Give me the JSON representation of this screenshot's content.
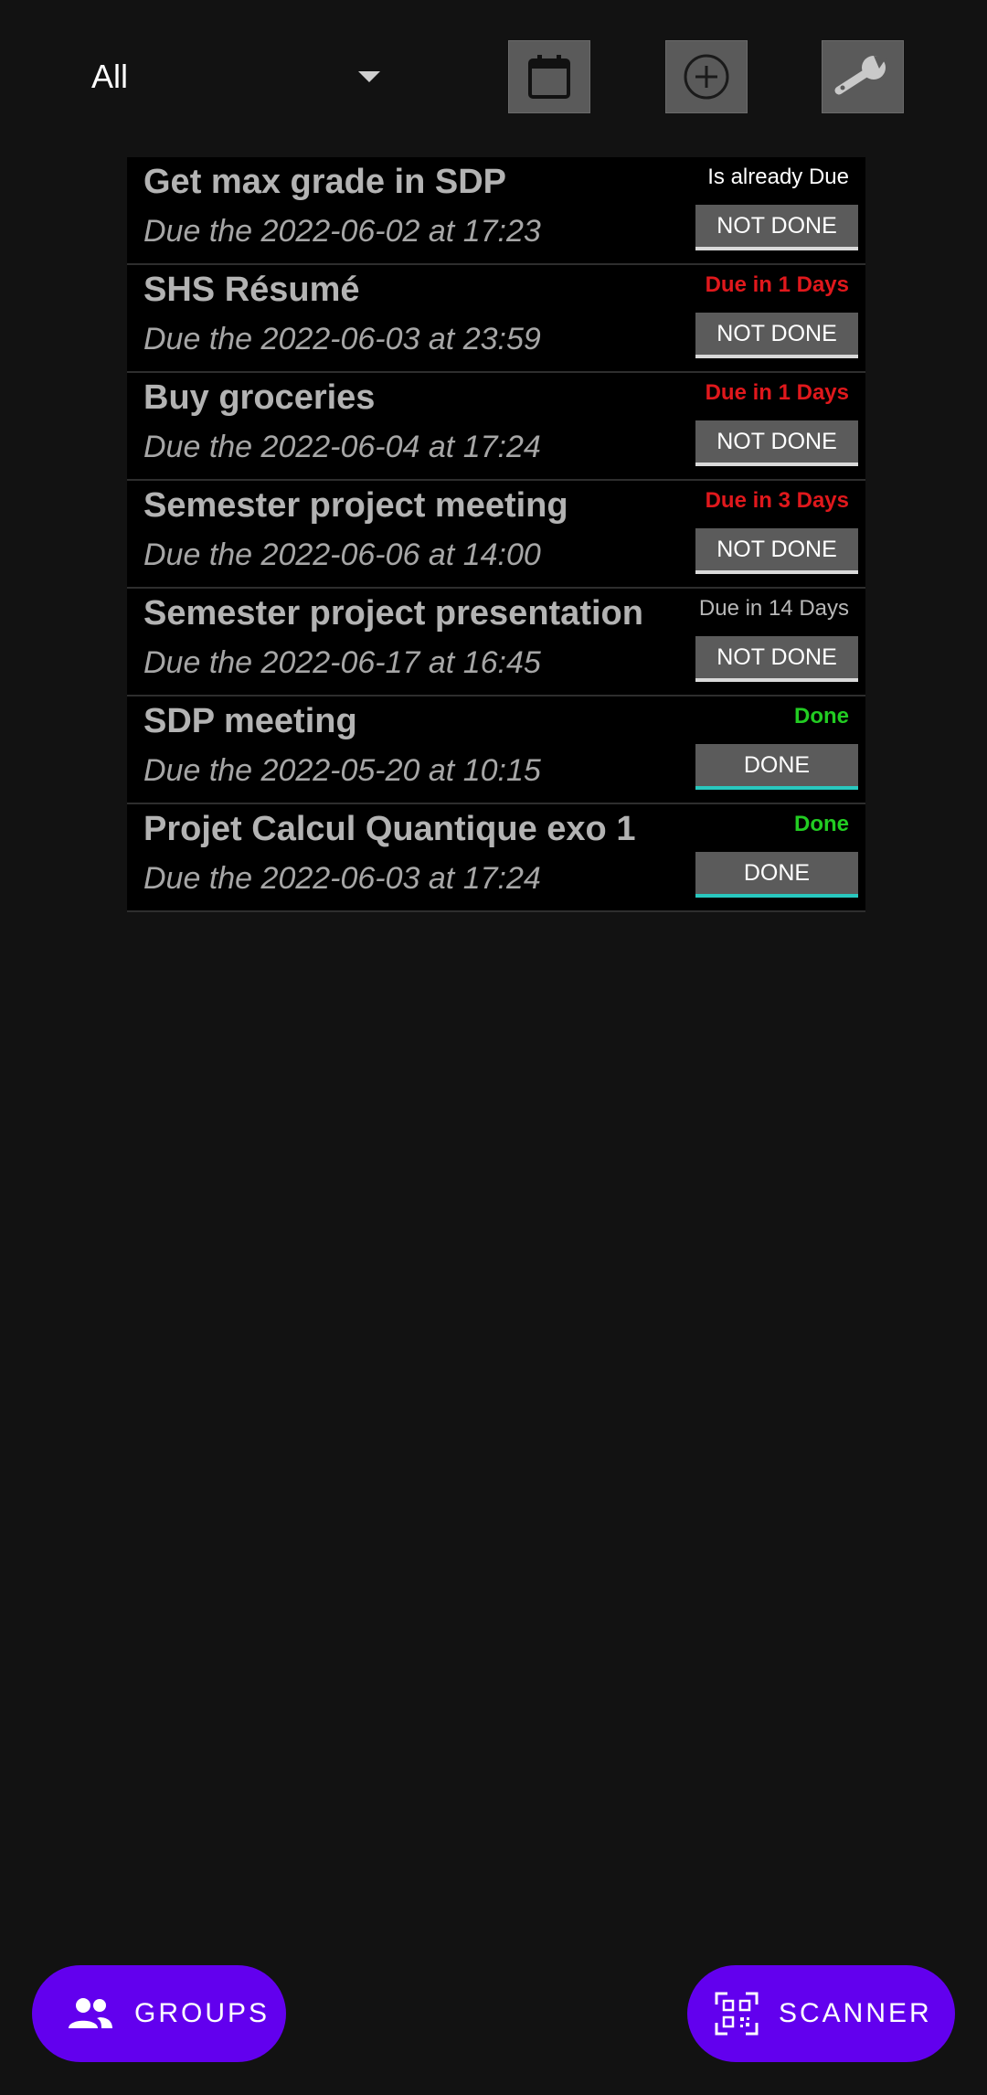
{
  "toolbar": {
    "filter_value": "All",
    "calendar_icon": "calendar-icon",
    "add_icon": "add-circle-icon",
    "settings_icon": "wrench-icon"
  },
  "tasks": [
    {
      "title": "Get max grade in SDP",
      "due": "Due the 2022-06-02 at 17:23",
      "status": "Is already Due",
      "status_color": "#ffffff",
      "button": "NOT DONE"
    },
    {
      "title": "SHS Résumé",
      "due": "Due the 2022-06-03 at 23:59",
      "status": "Due in 1 Days",
      "status_color": "#e0181c",
      "button": "NOT DONE"
    },
    {
      "title": "Buy groceries",
      "due": "Due the 2022-06-04 at 17:24",
      "status": "Due in 1 Days",
      "status_color": "#e0181c",
      "button": "NOT DONE"
    },
    {
      "title": "Semester project meeting",
      "due": "Due the 2022-06-06 at 14:00",
      "status": "Due in 3 Days",
      "status_color": "#e0181c",
      "button": "NOT DONE"
    },
    {
      "title": "Semester project presentation",
      "due": "Due the 2022-06-17 at 16:45",
      "status": "Due in 14 Days",
      "status_color": "#b8b8b8",
      "button": "NOT DONE"
    },
    {
      "title": "SDP meeting",
      "due": "Due the 2022-05-20 at 10:15",
      "status": "Done",
      "status_color": "#22cc22",
      "button": "DONE"
    },
    {
      "title": "Projet Calcul Quantique exo 1",
      "due": "Due the 2022-06-03 at 17:24",
      "status": "Done",
      "status_color": "#22cc22",
      "button": "DONE"
    }
  ],
  "bottom": {
    "groups_label": "GROUPS",
    "groups_icon": "people-icon",
    "scanner_label": "SCANNER",
    "scanner_icon": "qr-scanner-icon"
  },
  "colors": {
    "background": "#121212",
    "fab": "#6200ee",
    "done_underline": "#29c8bf"
  }
}
